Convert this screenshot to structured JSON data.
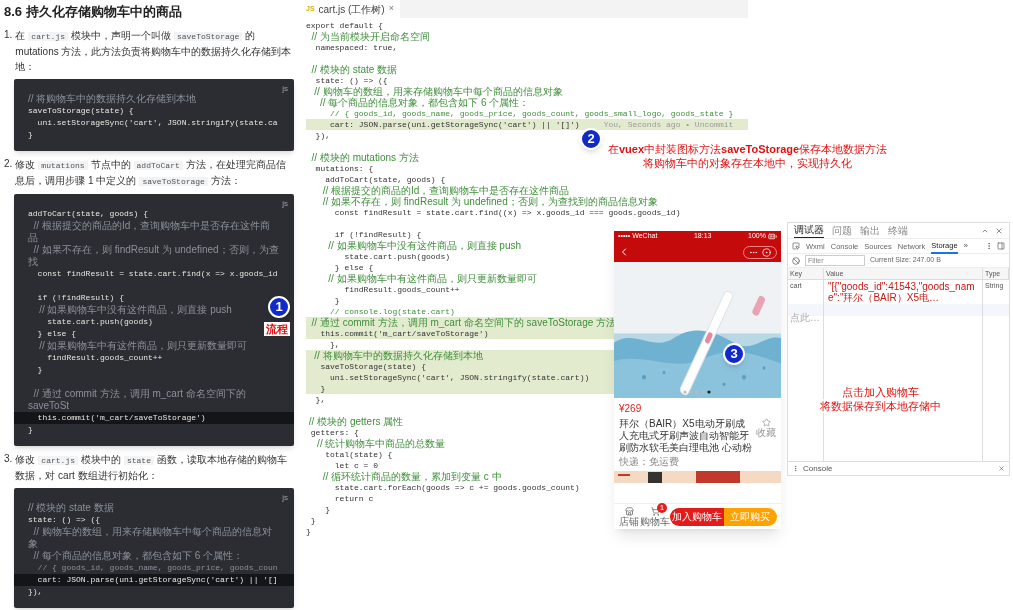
{
  "article": {
    "heading": "8.6 持久化存储购物车中的商品",
    "steps": [
      {
        "number": "1.",
        "segments": [
          {
            "kind": "text",
            "text": "在"
          },
          {
            "kind": "code",
            "text": "cart.js"
          },
          {
            "kind": "text",
            "text": "模块中，声明一个叫做"
          },
          {
            "kind": "code",
            "text": "saveToStorage"
          },
          {
            "kind": "text",
            "text": "的 mutations 方法，此方法负责将购物车中的数据持久化存储到本地："
          }
        ],
        "code": {
          "lang": "js",
          "lines": [
            {
              "kind": "comment",
              "text": "// 将购物车中的数据持久化存储到本地",
              "highlighted": false
            },
            {
              "kind": "code",
              "text": "saveToStorage(state) {",
              "highlighted": false
            },
            {
              "kind": "code",
              "text": "  uni.setStorageSync('cart', JSON.stringify(state.ca",
              "highlighted": false
            },
            {
              "kind": "code",
              "text": "}",
              "highlighted": false
            }
          ]
        }
      },
      {
        "number": "2.",
        "segments": [
          {
            "kind": "text",
            "text": "修改"
          },
          {
            "kind": "code",
            "text": "mutations"
          },
          {
            "kind": "text",
            "text": "节点中的"
          },
          {
            "kind": "code",
            "text": "addToCart"
          },
          {
            "kind": "text",
            "text": "方法，在处理完商品信息后，调用步骤 1 中定义的"
          },
          {
            "kind": "code",
            "text": "saveToStorage"
          },
          {
            "kind": "text",
            "text": "方法："
          }
        ],
        "code": {
          "lang": "js",
          "lines": [
            {
              "kind": "code",
              "text": "addToCart(state, goods) {",
              "highlighted": false
            },
            {
              "kind": "comment",
              "text": "  // 根据提交的商品的Id，查询购物车中是否存在这件商品",
              "highlighted": false
            },
            {
              "kind": "comment",
              "text": "  // 如果不存在，则 findResult 为 undefined；否则，为查找",
              "highlighted": false
            },
            {
              "kind": "code",
              "text": "  const findResult = state.cart.find(x => x.goods_id",
              "highlighted": false
            },
            {
              "kind": "blank"
            },
            {
              "kind": "code",
              "text": "  if (!findResult) {",
              "highlighted": false
            },
            {
              "kind": "comment",
              "text": "    // 如果购物车中没有这件商品，则直接 push",
              "highlighted": false
            },
            {
              "kind": "code",
              "text": "    state.cart.push(goods)",
              "highlighted": false
            },
            {
              "kind": "code",
              "text": "  } else {",
              "highlighted": false
            },
            {
              "kind": "comment",
              "text": "    // 如果购物车中有这件商品，则只更新数量即可",
              "highlighted": false
            },
            {
              "kind": "code",
              "text": "    findResult.goods_count++",
              "highlighted": false
            },
            {
              "kind": "code",
              "text": "  }",
              "highlighted": false
            },
            {
              "kind": "blank"
            },
            {
              "kind": "comment",
              "text": "  // 通过 commit 方法，调用 m_cart 命名空间下的 saveToSt",
              "highlighted": false
            },
            {
              "kind": "code",
              "text": "  this.commit('m_cart/saveToStorage')",
              "highlighted": true
            },
            {
              "kind": "code",
              "text": "}",
              "highlighted": false
            }
          ]
        }
      },
      {
        "number": "3.",
        "segments": [
          {
            "kind": "text",
            "text": "修改"
          },
          {
            "kind": "code",
            "text": "cart.js"
          },
          {
            "kind": "text",
            "text": "模块中的"
          },
          {
            "kind": "code",
            "text": "state"
          },
          {
            "kind": "text",
            "text": "函数，读取本地存储的购物车数据，对 cart 数组进行初始化："
          }
        ],
        "code": {
          "lang": "js",
          "lines": [
            {
              "kind": "comment",
              "text": "// 模块的 state 数据",
              "highlighted": false
            },
            {
              "kind": "code",
              "text": "state: () => ({",
              "highlighted": false
            },
            {
              "kind": "comment",
              "text": "  // 购物车的数组，用来存储购物车中每个商品的信息对象",
              "highlighted": false
            },
            {
              "kind": "comment",
              "text": "  // 每个商品的信息对象，都包含如下 6 个属性：",
              "highlighted": false
            },
            {
              "kind": "comment",
              "text": "  // { goods_id, goods_name, goods_price, goods_coun",
              "highlighted": false
            },
            {
              "kind": "code",
              "text": "  cart: JSON.parse(uni.getStorageSync('cart') || '[]",
              "highlighted": true
            },
            {
              "kind": "code",
              "text": "}),",
              "highlighted": false
            }
          ]
        }
      }
    ]
  },
  "editor": {
    "tab": {
      "badge": "JS",
      "title": "cart.js (工作树)",
      "close": "×"
    },
    "lines": [
      {
        "kind": "code",
        "text": "export default {",
        "highlighted": false
      },
      {
        "kind": "comment",
        "text": "  // 为当前模块开启命名空间",
        "highlighted": false
      },
      {
        "kind": "code",
        "text": "  namespaced: true,",
        "highlighted": false
      },
      {
        "kind": "blank"
      },
      {
        "kind": "comment",
        "text": "  // 模块的 state 数据",
        "highlighted": false
      },
      {
        "kind": "code",
        "text": "  state: () => ({",
        "highlighted": false
      },
      {
        "kind": "comment",
        "text": "   // 购物车的数组，用来存储购物车中每个商品的信息对象",
        "highlighted": false
      },
      {
        "kind": "comment",
        "text": "     // 每个商品的信息对象，都包含如下 6 个属性：",
        "highlighted": false
      },
      {
        "kind": "comment",
        "text": "     // { goods_id, goods_name, goods_price, goods_count, goods_small_logo, goods_state }",
        "highlighted": false
      },
      {
        "kind": "code",
        "text": "     cart: JSON.parse(uni.getStorageSync('cart') || '[]')",
        "highlighted": true,
        "blame": "You, Seconds ago • Uncommit"
      },
      {
        "kind": "code",
        "text": "  }),",
        "highlighted": false
      },
      {
        "kind": "blank"
      },
      {
        "kind": "comment",
        "text": "  // 模块的 mutations 方法",
        "highlighted": false
      },
      {
        "kind": "code",
        "text": "  mutations: {",
        "highlighted": false
      },
      {
        "kind": "code",
        "text": "    addToCart(state, goods) {",
        "highlighted": false
      },
      {
        "kind": "comment",
        "text": "      // 根据提交的商品的Id，查询购物车中是否存在这件商品",
        "highlighted": false
      },
      {
        "kind": "comment",
        "text": "      // 如果不存在，则 findResult 为 undefined；否则，为查找到的商品信息对象",
        "highlighted": false
      },
      {
        "kind": "code",
        "text": "      const findResult = state.cart.find((x) => x.goods_id === goods.goods_id)",
        "highlighted": false
      },
      {
        "kind": "blank"
      },
      {
        "kind": "code",
        "text": "      if (!findResult) {",
        "highlighted": false
      },
      {
        "kind": "comment",
        "text": "        // 如果购物车中没有这件商品，则直接 push",
        "highlighted": false
      },
      {
        "kind": "code",
        "text": "        state.cart.push(goods)",
        "highlighted": false
      },
      {
        "kind": "code",
        "text": "      } else {",
        "highlighted": false
      },
      {
        "kind": "comment",
        "text": "        // 如果购物车中有这件商品，则只更新数量即可",
        "highlighted": false
      },
      {
        "kind": "code",
        "text": "        findResult.goods_count++",
        "highlighted": false
      },
      {
        "kind": "code",
        "text": "      }",
        "highlighted": false
      },
      {
        "kind": "comment",
        "text": "     // console.log(state.cart)",
        "highlighted": false
      },
      {
        "kind": "comment",
        "text": "  // 通过 commit 方法，调用 m_cart 命名空间下的 saveToStorage 方法",
        "highlighted": true
      },
      {
        "kind": "code",
        "text": "   this.commit('m_cart/saveToStorage')",
        "highlighted": true
      },
      {
        "kind": "code",
        "text": "     },",
        "highlighted": false
      },
      {
        "kind": "comment",
        "text": "   // 将购物车中的数据持久化存储到本地",
        "highlighted": true
      },
      {
        "kind": "code",
        "text": "   saveToStorage(state) {",
        "highlighted": true
      },
      {
        "kind": "code",
        "text": "     uni.setStorageSync('cart', JSON.stringify(state.cart))",
        "highlighted": true
      },
      {
        "kind": "code",
        "text": "   }",
        "highlighted": true
      },
      {
        "kind": "code",
        "text": "  },",
        "highlighted": false
      },
      {
        "kind": "blank"
      },
      {
        "kind": "comment",
        "text": " // 模块的 getters 属性",
        "highlighted": false
      },
      {
        "kind": "code",
        "text": " getters: {",
        "highlighted": false
      },
      {
        "kind": "comment",
        "text": "    // 统计购物车中商品的总数量",
        "highlighted": false
      },
      {
        "kind": "code",
        "text": "    total(state) {",
        "highlighted": false
      },
      {
        "kind": "code",
        "text": "      let c = 0",
        "highlighted": false
      },
      {
        "kind": "comment",
        "text": "      // 循环统计商品的数量，累加到变量 c 中",
        "highlighted": false
      },
      {
        "kind": "code",
        "text": "      state.cart.forEach(goods => c += goods.goods_count)",
        "highlighted": false
      },
      {
        "kind": "code",
        "text": "      return c",
        "highlighted": false
      },
      {
        "kind": "code",
        "text": "    }",
        "highlighted": false
      },
      {
        "kind": "code",
        "text": " }",
        "highlighted": false
      },
      {
        "kind": "code",
        "text": "}",
        "highlighted": false
      }
    ]
  },
  "phone": {
    "status": {
      "carrier": "••••• WeChat",
      "time": "18:13",
      "battery": "100%"
    },
    "price": "¥269",
    "title": "拜尔（BAIR）X5电动牙刷成人充电式牙刷声波自动智能牙刷防水软毛美白理电池 心动粉",
    "favorite": "收藏",
    "shipping": "快递：免运费",
    "nav": [
      {
        "label": "店铺",
        "kind": "store"
      },
      {
        "label": "购物车",
        "kind": "cart",
        "badge": "1"
      }
    ],
    "buttons": [
      {
        "label": "加入购物车",
        "kind": "add"
      },
      {
        "label": "立即购买",
        "kind": "buy"
      }
    ]
  },
  "devtools": {
    "panel_tabs": [
      {
        "label": "调试器",
        "selected": true
      },
      {
        "label": "问题",
        "selected": false
      },
      {
        "label": "输出",
        "selected": false
      },
      {
        "label": "终端",
        "selected": false
      }
    ],
    "tool_tabs": [
      {
        "label": "Wxml",
        "selected": false
      },
      {
        "label": "Console",
        "selected": false
      },
      {
        "label": "Sources",
        "selected": false
      },
      {
        "label": "Network",
        "selected": false
      },
      {
        "label": "Storage",
        "selected": true
      }
    ],
    "more": "»",
    "filter_placeholder": "Filter",
    "size": "Current Size: 247.00 B",
    "columns": [
      "Key",
      "Value",
      "Type"
    ],
    "rows": [
      {
        "key": "cart",
        "value": "\"[{\"goods_id\":41543,\"goods_name\":\"拜尔（BAIR）X5电…",
        "type": "String"
      }
    ],
    "add_hint": "点此…",
    "drawer": "Console"
  },
  "annotations": [
    {
      "kind": "badge",
      "text": "1"
    },
    {
      "kind": "label",
      "text": "流程"
    },
    {
      "kind": "badge",
      "text": "2"
    },
    {
      "kind": "note",
      "lines": [
        "在**vuex**中封装图标方法**saveToStorage**保存本地数据方法",
        "将购物车中的对象存在本地中，实现持久化"
      ]
    },
    {
      "kind": "badge",
      "text": "3"
    },
    {
      "kind": "note",
      "lines": [
        "点击加入购物车",
        "将数据保存到本地存储中"
      ]
    }
  ]
}
